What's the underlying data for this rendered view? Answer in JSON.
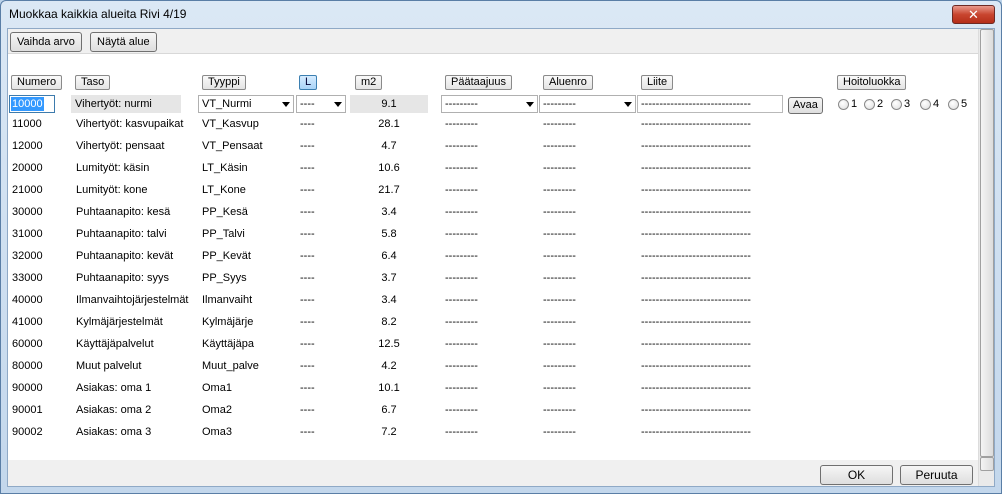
{
  "window": {
    "title": "Muokkaa kaikkia alueita   Rivi 4/19",
    "close_label": "✕"
  },
  "toolbar": {
    "change_value": "Vaihda arvo",
    "show_area": "Näytä alue"
  },
  "headers": {
    "numero": "Numero",
    "taso": "Taso",
    "tyyppi": "Tyyppi",
    "l": "L",
    "m2": "m2",
    "paataajuus": "Päätaajuus",
    "aluenro": "Aluenro",
    "liite": "Liite",
    "hoitoluokka": "Hoitoluokka"
  },
  "edit_row": {
    "numero": "10000",
    "taso": "Vihertyöt: nurmi",
    "tyyppi": "VT_Nurmi",
    "l": "----",
    "m2": "9.1",
    "paataajuus": "---------",
    "aluenro": "---------",
    "liite": "------------------------------",
    "open_button": "Avaa",
    "hoitoluokka_options": [
      "1",
      "2",
      "3",
      "4",
      "5"
    ]
  },
  "rows": [
    {
      "numero": "11000",
      "taso": "Vihertyöt: kasvupaikat",
      "tyyppi": "VT_Kasvup",
      "l": "----",
      "m2": "28.1",
      "paataajuus": "---------",
      "aluenro": "---------",
      "liite": "------------------------------"
    },
    {
      "numero": "12000",
      "taso": "Vihertyöt: pensaat",
      "tyyppi": "VT_Pensaat",
      "l": "----",
      "m2": "4.7",
      "paataajuus": "---------",
      "aluenro": "---------",
      "liite": "------------------------------"
    },
    {
      "numero": "20000",
      "taso": "Lumityöt: käsin",
      "tyyppi": "LT_Käsin",
      "l": "----",
      "m2": "10.6",
      "paataajuus": "---------",
      "aluenro": "---------",
      "liite": "------------------------------"
    },
    {
      "numero": "21000",
      "taso": "Lumityöt: kone",
      "tyyppi": "LT_Kone",
      "l": "----",
      "m2": "21.7",
      "paataajuus": "---------",
      "aluenro": "---------",
      "liite": "------------------------------"
    },
    {
      "numero": "30000",
      "taso": "Puhtaanapito: kesä",
      "tyyppi": "PP_Kesä",
      "l": "----",
      "m2": "3.4",
      "paataajuus": "---------",
      "aluenro": "---------",
      "liite": "------------------------------"
    },
    {
      "numero": "31000",
      "taso": "Puhtaanapito: talvi",
      "tyyppi": "PP_Talvi",
      "l": "----",
      "m2": "5.8",
      "paataajuus": "---------",
      "aluenro": "---------",
      "liite": "------------------------------"
    },
    {
      "numero": "32000",
      "taso": "Puhtaanapito: kevät",
      "tyyppi": "PP_Kevät",
      "l": "----",
      "m2": "6.4",
      "paataajuus": "---------",
      "aluenro": "---------",
      "liite": "------------------------------"
    },
    {
      "numero": "33000",
      "taso": "Puhtaanapito: syys",
      "tyyppi": "PP_Syys",
      "l": "----",
      "m2": "3.7",
      "paataajuus": "---------",
      "aluenro": "---------",
      "liite": "------------------------------"
    },
    {
      "numero": "40000",
      "taso": "Ilmanvaihtojärjestelmät",
      "tyyppi": "Ilmanvaiht",
      "l": "----",
      "m2": "3.4",
      "paataajuus": "---------",
      "aluenro": "---------",
      "liite": "------------------------------"
    },
    {
      "numero": "41000",
      "taso": "Kylmäjärjestelmät",
      "tyyppi": "Kylmäjärje",
      "l": "----",
      "m2": "8.2",
      "paataajuus": "---------",
      "aluenro": "---------",
      "liite": "------------------------------"
    },
    {
      "numero": "60000",
      "taso": "Käyttäjäpalvelut",
      "tyyppi": "Käyttäjäpa",
      "l": "----",
      "m2": "12.5",
      "paataajuus": "---------",
      "aluenro": "---------",
      "liite": "------------------------------"
    },
    {
      "numero": "80000",
      "taso": "Muut palvelut",
      "tyyppi": "Muut_palve",
      "l": "----",
      "m2": "4.2",
      "paataajuus": "---------",
      "aluenro": "---------",
      "liite": "------------------------------"
    },
    {
      "numero": "90000",
      "taso": "Asiakas: oma 1",
      "tyyppi": "Oma1",
      "l": "----",
      "m2": "10.1",
      "paataajuus": "---------",
      "aluenro": "---------",
      "liite": "------------------------------"
    },
    {
      "numero": "90001",
      "taso": "Asiakas: oma 2",
      "tyyppi": "Oma2",
      "l": "----",
      "m2": "6.7",
      "paataajuus": "---------",
      "aluenro": "---------",
      "liite": "------------------------------"
    },
    {
      "numero": "90002",
      "taso": "Asiakas: oma 3",
      "tyyppi": "Oma3",
      "l": "----",
      "m2": "7.2",
      "paataajuus": "---------",
      "aluenro": "---------",
      "liite": "------------------------------"
    }
  ],
  "footer": {
    "ok": "OK",
    "cancel": "Peruuta"
  }
}
